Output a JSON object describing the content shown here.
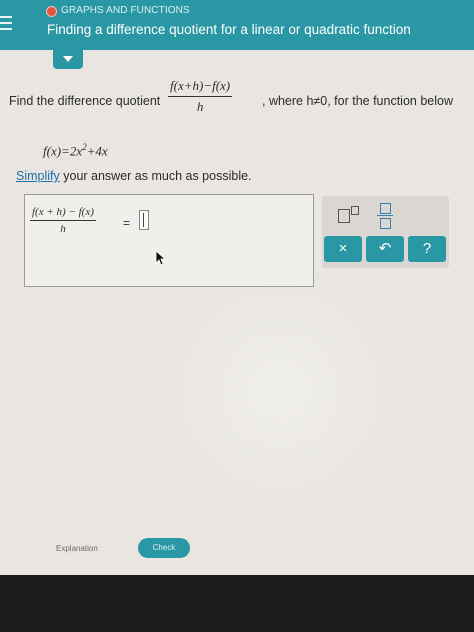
{
  "header": {
    "category": "GRAPHS AND FUNCTIONS",
    "topic": "Finding a difference quotient for a linear or quadratic function",
    "colors": {
      "bar": "#2a97a5",
      "status_dot": "#e6553f"
    }
  },
  "prompt": {
    "lead": "Find the difference quotient",
    "quotient_numerator": "f(x+h)−f(x)",
    "quotient_denominator": "h",
    "condition": ", where h≠0, for the function below"
  },
  "function": {
    "lhs": "f(x)=2x",
    "exponent": "2",
    "rhs": "+4x"
  },
  "instruction": {
    "link": "Simplify",
    "rest": " your answer as much as possible."
  },
  "answer": {
    "numerator": "f(x + h) − f(x)",
    "denominator": "h",
    "equals": "="
  },
  "keypad": {
    "clear": "×",
    "undo": "↶",
    "help": "?"
  },
  "footer": {
    "explanation": "Explanation",
    "check": "Check"
  }
}
